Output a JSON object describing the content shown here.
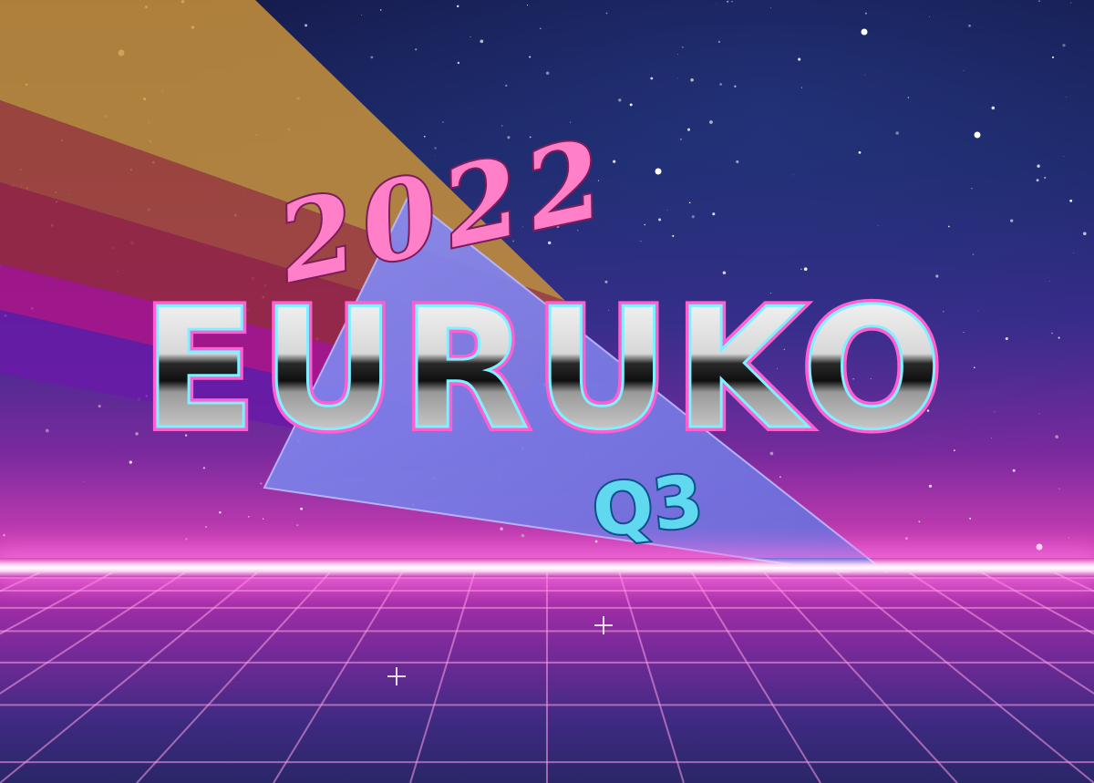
{
  "poster": {
    "year": "2022",
    "title": "EURUKO",
    "quarter": "Q3"
  },
  "colors": {
    "sky_top": "#141a4a",
    "sky_bottom": "#e24ec0",
    "horizon_glow": "#ffd6f6",
    "triangle": "#7f7fe8",
    "year_pink": "#ff7fc8",
    "quarter_cyan": "#5fd8f0",
    "chrome_light": "#f2f2f2",
    "chrome_dark": "#1a1a1a",
    "outline_pink": "#ff5fd0",
    "outline_cyan": "#7ff0ff"
  },
  "icons": {
    "stars": "starfield",
    "triangle": "retro-triangle",
    "rays": "rainbow-beam",
    "grid": "neon-grid"
  }
}
